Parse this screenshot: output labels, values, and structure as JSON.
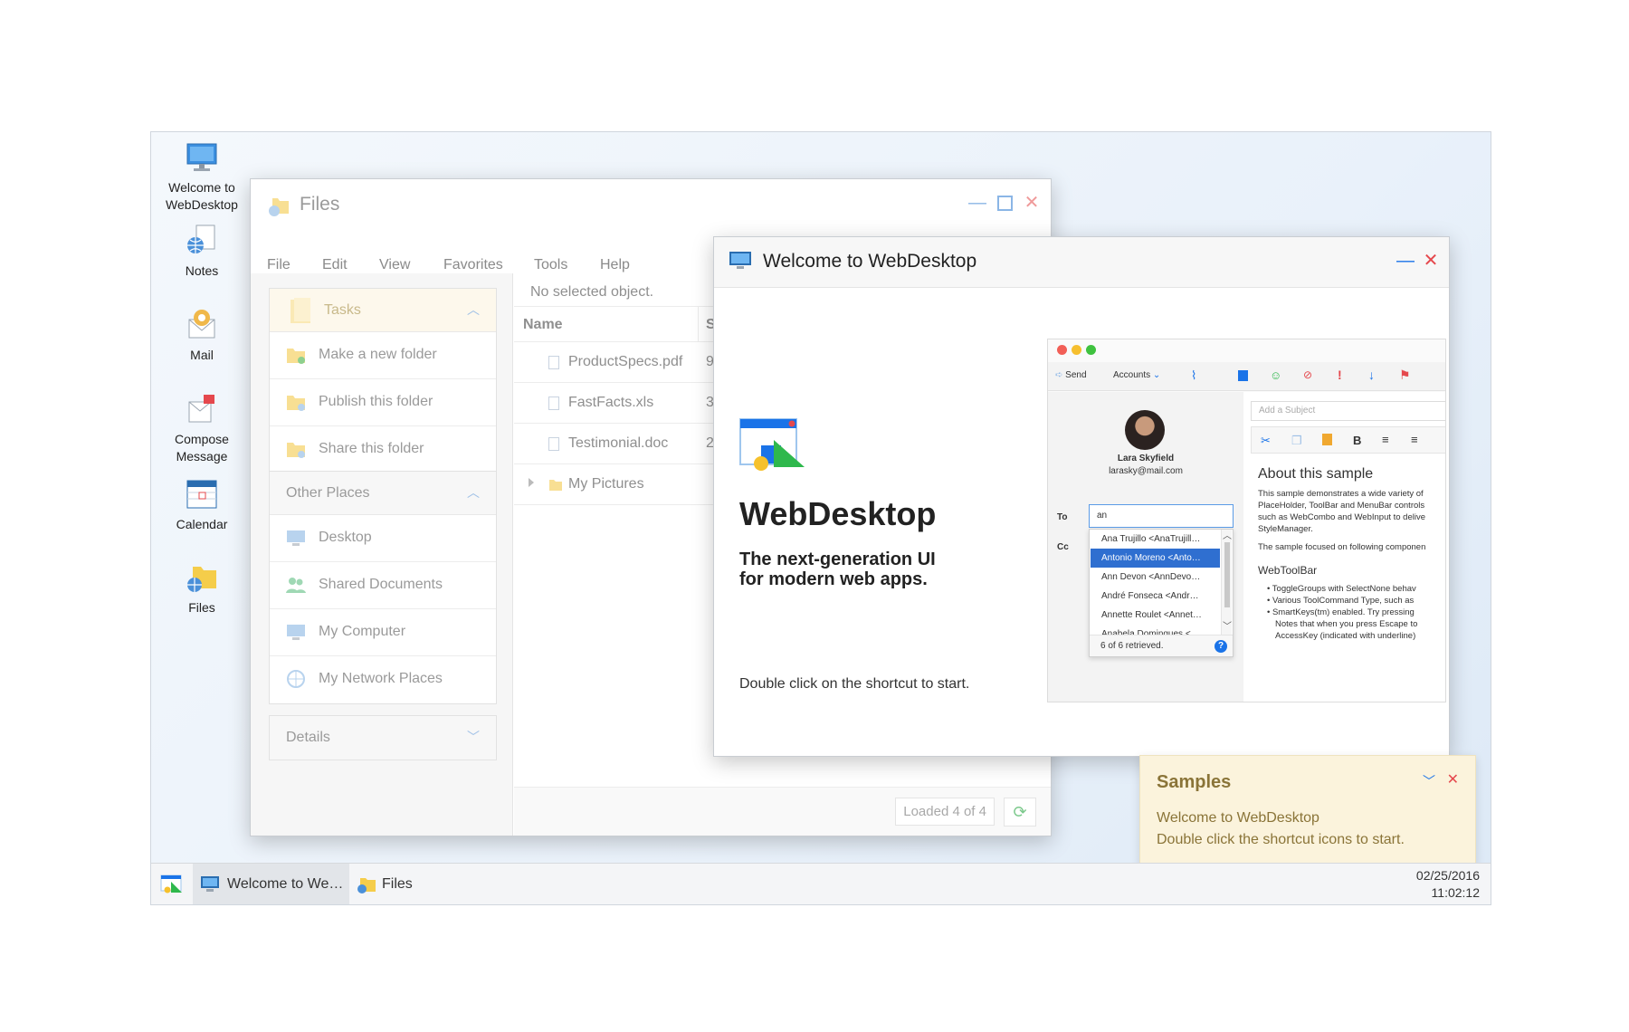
{
  "shortcuts": [
    {
      "label": "Welcome to\nWebDesktop",
      "icon": "monitor-icon"
    },
    {
      "label": "Notes",
      "icon": "notes-icon"
    },
    {
      "label": "Mail",
      "icon": "mail-icon"
    },
    {
      "label": "Compose\nMessage",
      "icon": "compose-icon"
    },
    {
      "label": "Calendar",
      "icon": "calendar-icon"
    },
    {
      "label": "Files",
      "icon": "folder-icon"
    }
  ],
  "files_window": {
    "title": "Files",
    "menu": [
      "File",
      "Edit",
      "View",
      "Favorites",
      "Tools",
      "Help"
    ],
    "tasks": {
      "header": "Tasks",
      "items": [
        "Make a new folder",
        "Publish this folder",
        "Share this folder"
      ]
    },
    "other_places": {
      "header": "Other Places",
      "items": [
        "Desktop",
        "Shared Documents",
        "My Computer",
        "My Network Places"
      ]
    },
    "details": {
      "header": "Details"
    },
    "status": "No selected object.",
    "columns": [
      "Name",
      "S"
    ],
    "rows": [
      {
        "name": "ProductSpecs.pdf",
        "size": "9"
      },
      {
        "name": "FastFacts.xls",
        "size": "3"
      },
      {
        "name": "Testimonial.doc",
        "size": "2"
      },
      {
        "name": "My Pictures",
        "size": ""
      }
    ],
    "loaded": "Loaded 4 of 4"
  },
  "welcome_window": {
    "title": "Welcome to WebDesktop",
    "heading": "WebDesktop",
    "tagline1": "The next-generation UI",
    "tagline2": "for modern web apps.",
    "hint": "Double click on the shortcut to start."
  },
  "mock_mail": {
    "send": "Send",
    "accounts": "Accounts",
    "subject_placeholder": "Add a Subject",
    "user_name": "Lara Skyfield",
    "user_email": "larasky@mail.com",
    "to_label": "To",
    "cc_label": "Cc",
    "to_value": "an",
    "suggestions": [
      "Ana Trujillo <AnaTrujill…",
      "Antonio Moreno <Anto…",
      "Ann Devon <AnnDevo…",
      "André Fonseca <Andr…",
      "Annette Roulet <Annet…",
      "Anabela Dominques <"
    ],
    "retrieved": "6 of 6 retrieved.",
    "about_title": "About this sample",
    "about_lines": [
      "This sample demonstrates a wide variety of",
      "PlaceHolder, ToolBar and MenuBar controls",
      "such as WebCombo and WebInput to delive",
      "StyleManager."
    ],
    "about_focus": "The sample focused on following componen",
    "toolbar_title": "WebToolBar",
    "bullets": [
      "ToggleGroups with SelectNone behav",
      "Various ToolCommand Type, such as",
      "SmartKeys(tm) enabled. Try pressing",
      "Notes that when you press Escape to",
      "AccessKey (indicated with underline)"
    ]
  },
  "toast": {
    "title": "Samples",
    "line1": "Welcome to WebDesktop",
    "line2": "Double click the shortcut icons to start."
  },
  "taskbar": {
    "items": [
      "Welcome to We…",
      "Files"
    ],
    "date": "02/25/2016",
    "time": "11:02:12"
  },
  "colors": {
    "accent": "#1a73e8",
    "close_red": "#e5484d",
    "folder_yellow": "#f5cd4a",
    "selected_blue": "#2f6fd0"
  }
}
